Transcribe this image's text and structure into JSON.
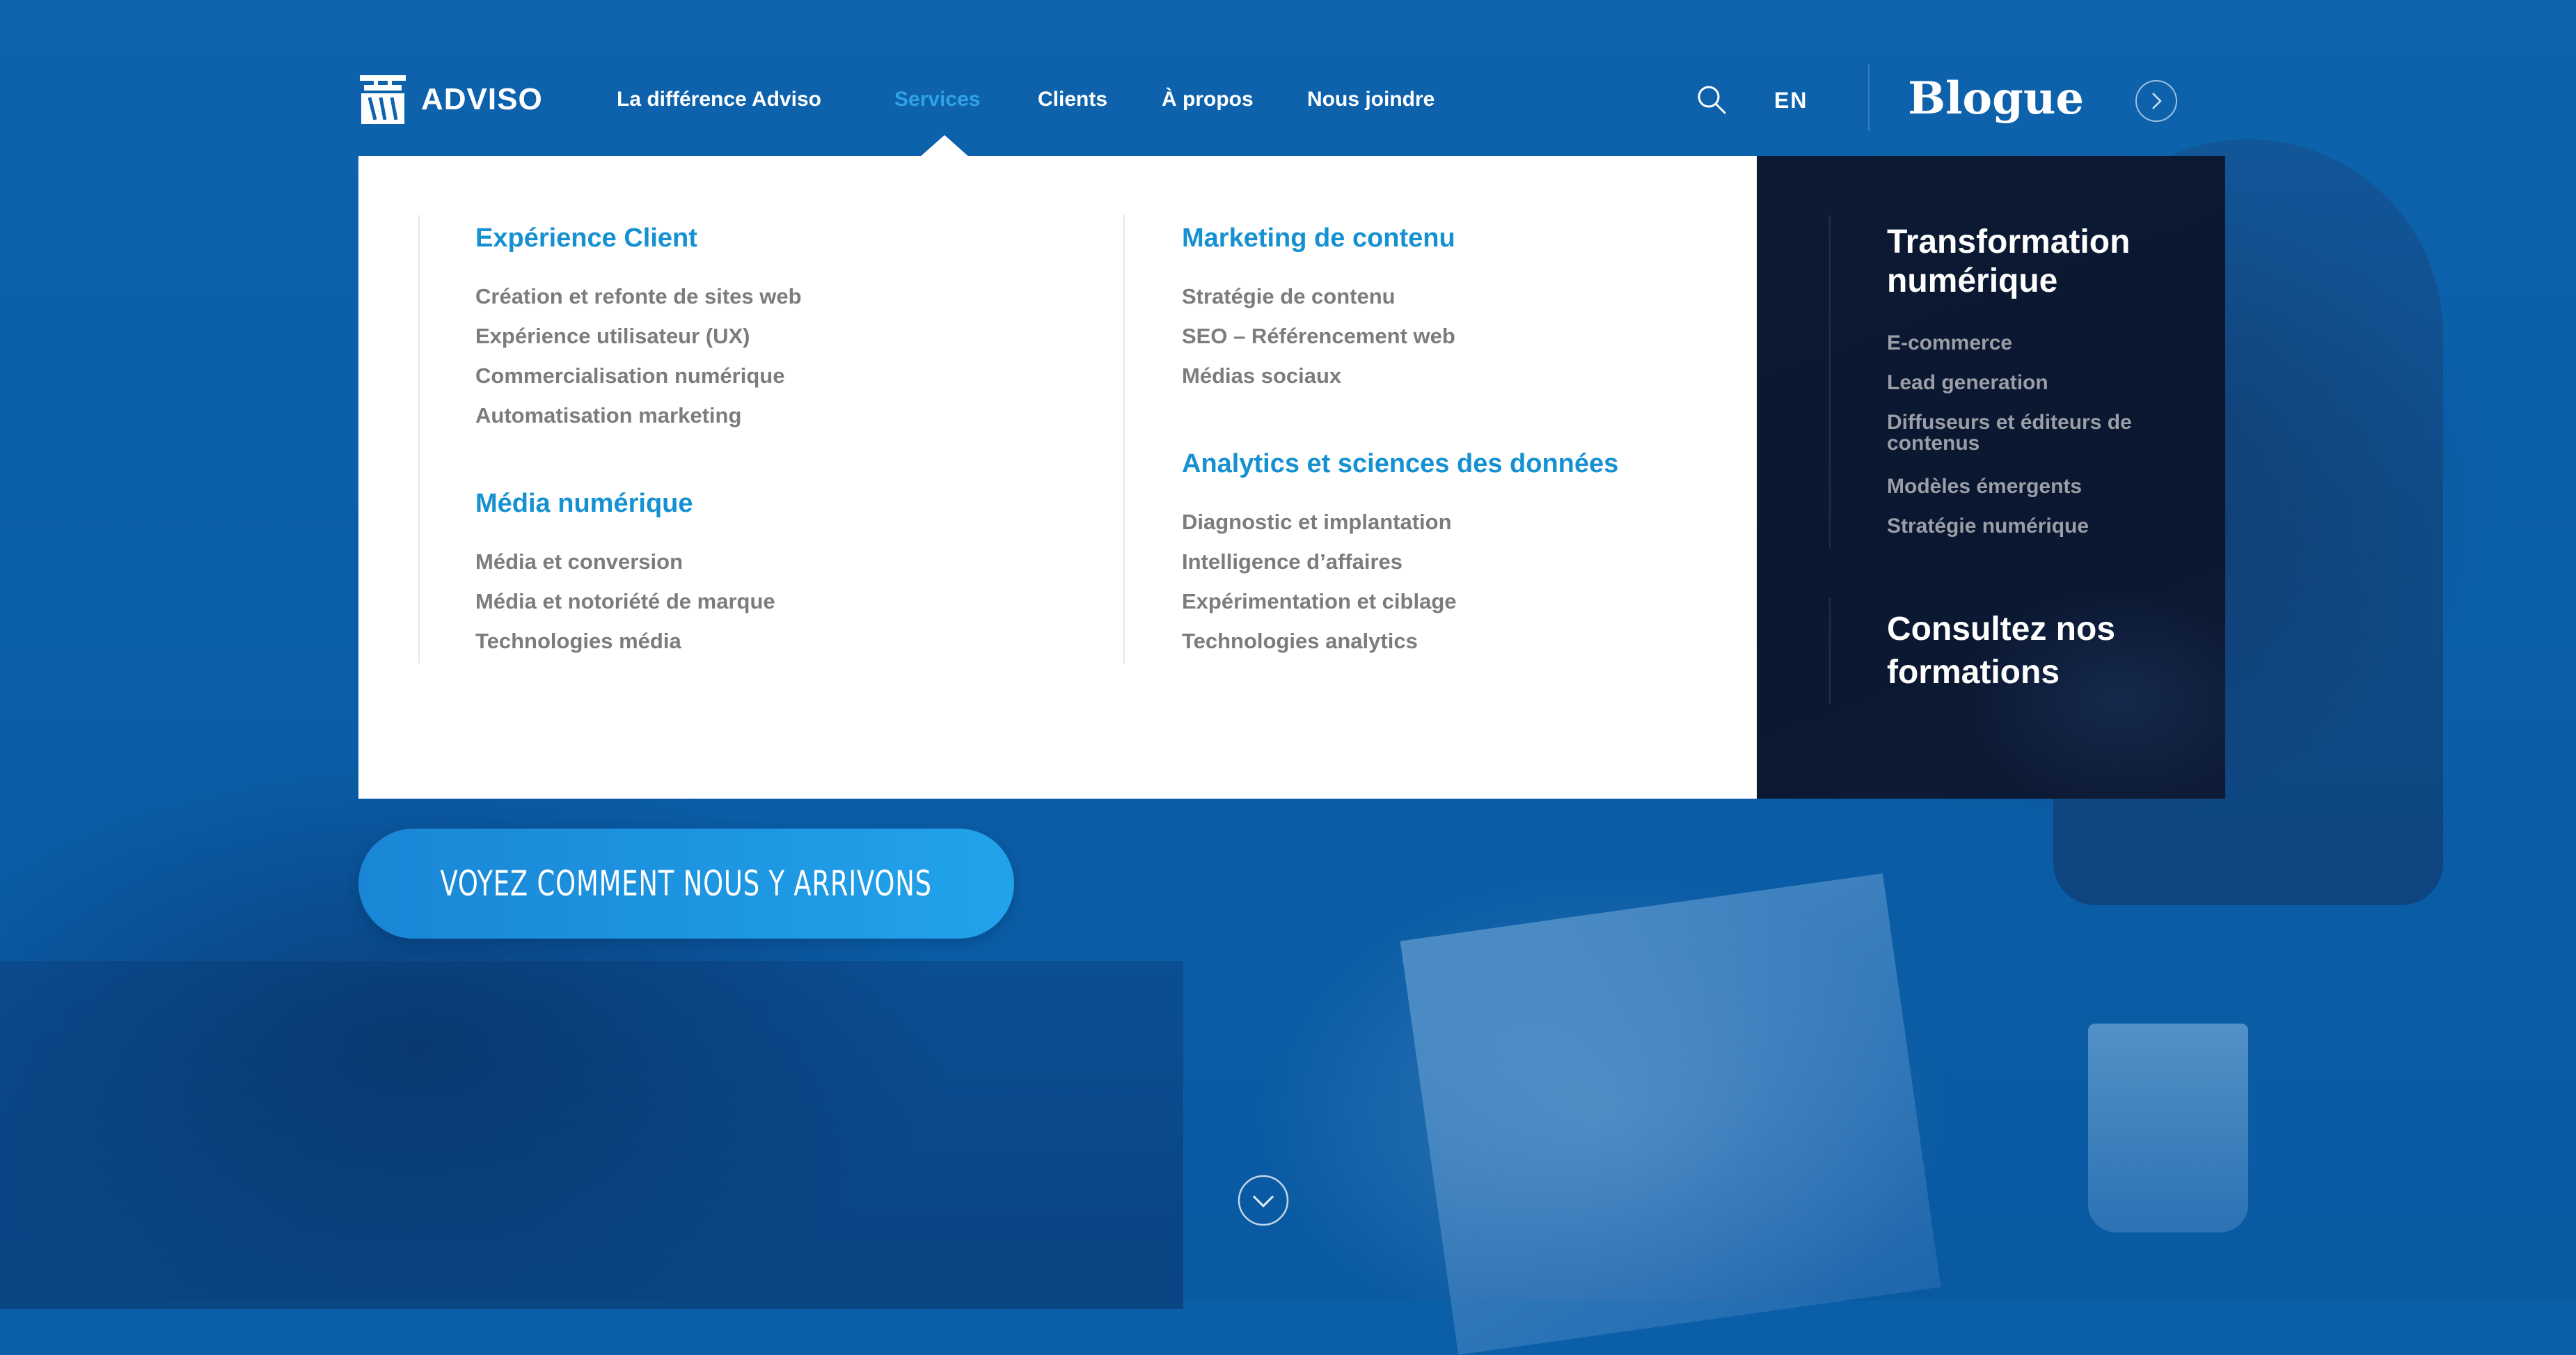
{
  "header": {
    "logo_text": "ADVISO",
    "nav": [
      {
        "label": "La différence Adviso"
      },
      {
        "label": "Services"
      },
      {
        "label": "Clients"
      },
      {
        "label": "À propos"
      },
      {
        "label": "Nous joindre"
      }
    ],
    "active_nav": "Services",
    "lang": "EN",
    "blog": "Blogue"
  },
  "menu": {
    "col1": {
      "sections": [
        {
          "title": "Expérience Client",
          "links": [
            "Création et refonte de sites web",
            "Expérience utilisateur (UX)",
            "Commercialisation numérique",
            "Automatisation marketing"
          ]
        },
        {
          "title": "Média numérique",
          "links": [
            "Média et conversion",
            "Média et notoriété de marque",
            "Technologies média"
          ]
        }
      ]
    },
    "col2": {
      "sections": [
        {
          "title": "Marketing de contenu",
          "links": [
            "Stratégie de contenu",
            "SEO – Référencement web",
            "Médias sociaux"
          ]
        },
        {
          "title": "Analytics et sciences des données",
          "links": [
            "Diagnostic et implantation",
            "Intelligence d’affaires",
            "Expérimentation et ciblage",
            "Technologies analytics"
          ]
        }
      ]
    },
    "dark": {
      "title": "Transformation numérique",
      "links": [
        "E-commerce",
        "Lead generation",
        "Diffuseurs et éditeurs de contenus",
        "Modèles émergents",
        "Stratégie numérique"
      ],
      "title2": "Consultez nos formations"
    }
  },
  "cta": {
    "label": "VOYEZ COMMENT NOUS Y ARRIVONS"
  },
  "colors": {
    "accent": "#1591d2",
    "cta": "#21a3ea",
    "dark_panel": "#0d1a33",
    "link_gray": "#7c7c7c"
  }
}
